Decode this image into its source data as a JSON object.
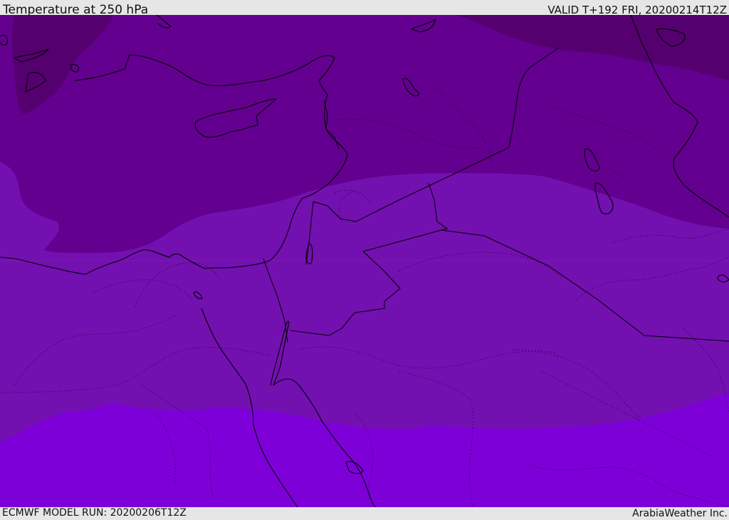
{
  "header": {
    "title": "Temperature at 250 hPa",
    "valid": "VALID T+192 FRI, 20200214T12Z"
  },
  "footer": {
    "model_run": "ECMWF MODEL RUN: 20200206T12Z",
    "credit": "ArabiaWeather Inc."
  },
  "map": {
    "variable": "Temperature",
    "level": "250 hPa",
    "colors": {
      "band_coldest": "#54006f",
      "band_cold": "#63008f",
      "band_mid": "#7310b0",
      "band_warm": "#7e00d9",
      "coastline": "#000000",
      "border": "#000000"
    }
  }
}
